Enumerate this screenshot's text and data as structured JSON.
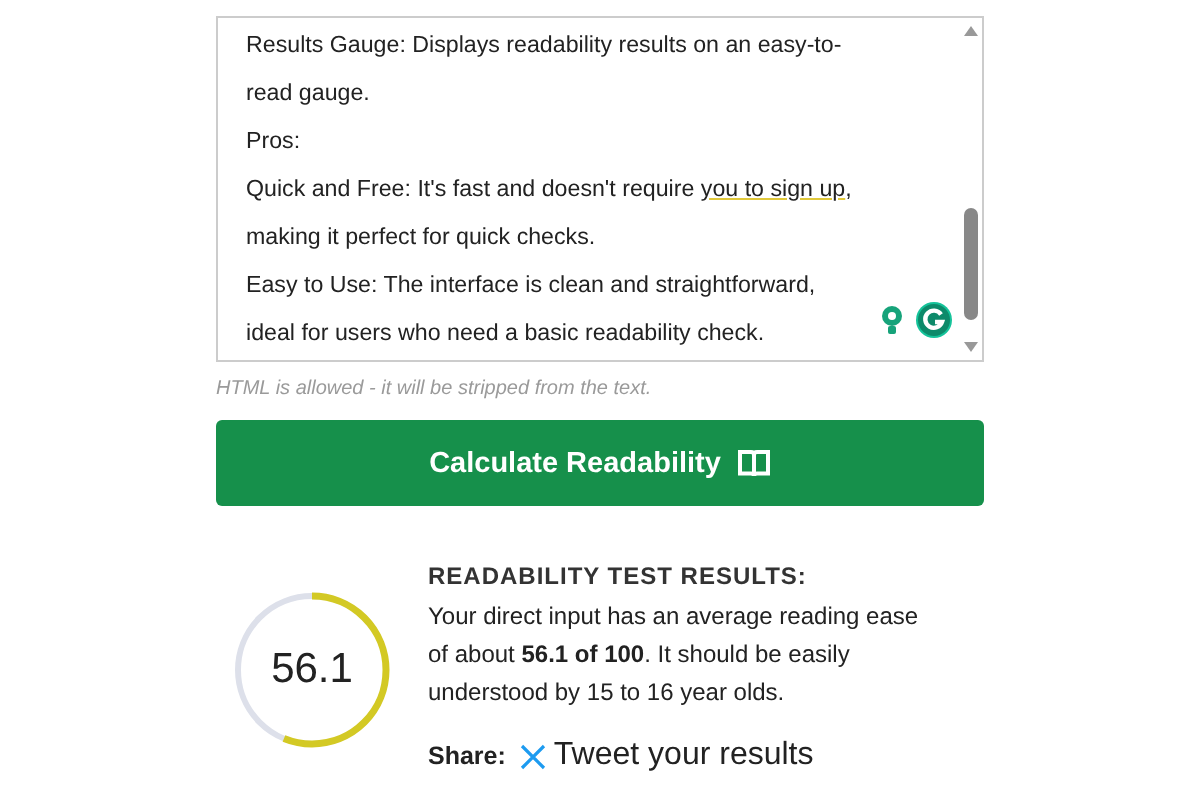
{
  "editor": {
    "paragraphs": [
      {
        "segments": [
          {
            "text": "Results Gauge: Displays readability results on an easy-to-read gauge.",
            "flagged": false
          }
        ]
      },
      {
        "segments": [
          {
            "text": "Pros:",
            "flagged": false
          }
        ]
      },
      {
        "segments": [
          {
            "text": "Quick and Free: It's fast and doesn't require ",
            "flagged": false
          },
          {
            "text": "you to sign up",
            "flagged": true
          },
          {
            "text": ", making it perfect for quick checks.",
            "flagged": false
          }
        ]
      },
      {
        "segments": [
          {
            "text": "Easy to Use: The interface is clean and straightforward, ideal for users who need a basic readability check.",
            "flagged": false
          }
        ]
      }
    ],
    "hint": "HTML is allowed - it will be stripped from the text."
  },
  "calculate_button": {
    "label": "Calculate Readability"
  },
  "results": {
    "score": "56.1",
    "level": 0.561,
    "heading": "READABILITY TEST RESULTS:",
    "summary": "Your direct input has an average reading ease of about **56.1 of 100**. It should be easily understood by 15 to 16 year olds.",
    "share_label": "Share:",
    "tweet_link": "Tweet your results"
  }
}
